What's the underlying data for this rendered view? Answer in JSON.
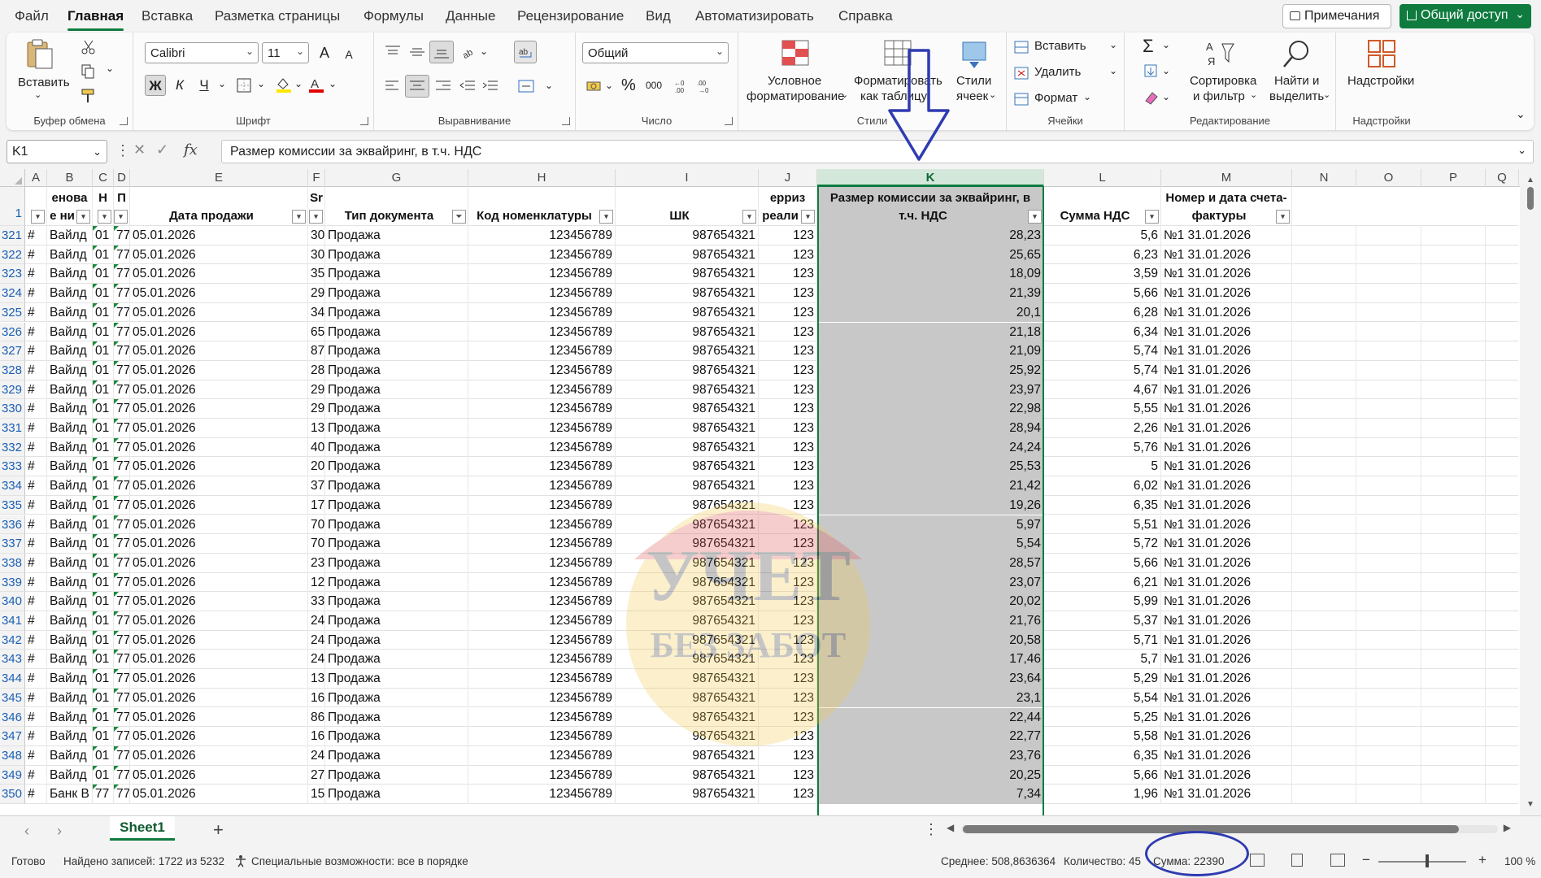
{
  "menu": {
    "items": [
      "Файл",
      "Главная",
      "Вставка",
      "Разметка страницы",
      "Формулы",
      "Данные",
      "Рецензирование",
      "Вид",
      "Автоматизировать",
      "Справка"
    ],
    "notes_label": "Примечания",
    "share_label": "Общий доступ"
  },
  "ribbon": {
    "clipboard": {
      "paste_label": "Вставить",
      "group_label": "Буфер обмена"
    },
    "font": {
      "name": "Calibri",
      "size": "11",
      "bold": "Ж",
      "italic": "К",
      "underline": "Ч",
      "group_label": "Шрифт",
      "grow": "A",
      "shrink": "A"
    },
    "alignment": {
      "group_label": "Выравнивание"
    },
    "number": {
      "format": "Общий",
      "percent": "%",
      "thousands": "000",
      "group_label": "Число"
    },
    "styles": {
      "cond_format_l1": "Условное",
      "cond_format_l2": "форматирование",
      "format_table_l1": "Форматировать",
      "format_table_l2": "как таблицу",
      "cell_styles_l1": "Стили",
      "cell_styles_l2": "ячеек",
      "group_label": "Стили"
    },
    "cells": {
      "insert": "Вставить",
      "delete": "Удалить",
      "format": "Формат",
      "group_label": "Ячейки"
    },
    "editing": {
      "sort_l1": "Сортировка",
      "sort_l2": "и фильтр",
      "find_l1": "Найти и",
      "find_l2": "выделить",
      "group_label": "Редактирование"
    },
    "addins": {
      "label": "Надстройки",
      "group_label": "Надстройки"
    }
  },
  "formula_bar": {
    "name_box": "K1",
    "fx": "fx",
    "content": "Размер комиссии за эквайринг, в т.ч. НДС"
  },
  "columns": [
    "A",
    "B",
    "C",
    "D",
    "E",
    "F",
    "G",
    "H",
    "I",
    "J",
    "K",
    "L",
    "M",
    "N",
    "O",
    "P",
    "Q"
  ],
  "header_row": {
    "number": "1",
    "B_l1": "енова",
    "B_l2": "е ни",
    "C_l1": "Н",
    "D_l1": "П",
    "E": "Дата продажи",
    "F_l1": "Sr",
    "G": "Тип документа",
    "H": "Код номенклатуры",
    "I": "ШК",
    "J_l1": "ерриз",
    "J_l2": "реали",
    "K_l1": "Размер комиссии за эквайринг, в",
    "K_l2": "т.ч. НДС",
    "L": "Сумма НДС",
    "M_l1": "Номер и дата счета-",
    "M_l2": "фактуры"
  },
  "rows": [
    {
      "n": "321",
      "a": "#",
      "b": "Вайлд",
      "c": "01",
      "d": "77",
      "e": "05.01.2026",
      "f": "30",
      "g": "Продажа",
      "h": "123456789",
      "i": "987654321",
      "j": "123",
      "k": "28,23",
      "l": "5,6",
      "m": "№1 31.01.2026"
    },
    {
      "n": "322",
      "a": "#",
      "b": "Вайлд",
      "c": "01",
      "d": "77",
      "e": "05.01.2026",
      "f": "30",
      "g": "Продажа",
      "h": "123456789",
      "i": "987654321",
      "j": "123",
      "k": "25,65",
      "l": "6,23",
      "m": "№1 31.01.2026"
    },
    {
      "n": "323",
      "a": "#",
      "b": "Вайлд",
      "c": "01",
      "d": "77",
      "e": "05.01.2026",
      "f": "35",
      "g": "Продажа",
      "h": "123456789",
      "i": "987654321",
      "j": "123",
      "k": "18,09",
      "l": "3,59",
      "m": "№1 31.01.2026"
    },
    {
      "n": "324",
      "a": "#",
      "b": "Вайлд",
      "c": "01",
      "d": "77",
      "e": "05.01.2026",
      "f": "29",
      "g": "Продажа",
      "h": "123456789",
      "i": "987654321",
      "j": "123",
      "k": "21,39",
      "l": "5,66",
      "m": "№1 31.01.2026"
    },
    {
      "n": "325",
      "a": "#",
      "b": "Вайлд",
      "c": "01",
      "d": "77",
      "e": "05.01.2026",
      "f": "34",
      "g": "Продажа",
      "h": "123456789",
      "i": "987654321",
      "j": "123",
      "k": "20,1",
      "l": "6,28",
      "m": "№1 31.01.2026"
    },
    {
      "n": "326",
      "a": "#",
      "b": "Вайлд",
      "c": "01",
      "d": "77",
      "e": "05.01.2026",
      "f": "65",
      "g": "Продажа",
      "h": "123456789",
      "i": "987654321",
      "j": "123",
      "k": "21,18",
      "l": "6,34",
      "m": "№1 31.01.2026"
    },
    {
      "n": "327",
      "a": "#",
      "b": "Вайлд",
      "c": "01",
      "d": "77",
      "e": "05.01.2026",
      "f": "87",
      "g": "Продажа",
      "h": "123456789",
      "i": "987654321",
      "j": "123",
      "k": "21,09",
      "l": "5,74",
      "m": "№1 31.01.2026"
    },
    {
      "n": "328",
      "a": "#",
      "b": "Вайлд",
      "c": "01",
      "d": "77",
      "e": "05.01.2026",
      "f": "28",
      "g": "Продажа",
      "h": "123456789",
      "i": "987654321",
      "j": "123",
      "k": "25,92",
      "l": "5,74",
      "m": "№1 31.01.2026"
    },
    {
      "n": "329",
      "a": "#",
      "b": "Вайлд",
      "c": "01",
      "d": "77",
      "e": "05.01.2026",
      "f": "29",
      "g": "Продажа",
      "h": "123456789",
      "i": "987654321",
      "j": "123",
      "k": "23,97",
      "l": "4,67",
      "m": "№1 31.01.2026"
    },
    {
      "n": "330",
      "a": "#",
      "b": "Вайлд",
      "c": "01",
      "d": "77",
      "e": "05.01.2026",
      "f": "29",
      "g": "Продажа",
      "h": "123456789",
      "i": "987654321",
      "j": "123",
      "k": "22,98",
      "l": "5,55",
      "m": "№1 31.01.2026"
    },
    {
      "n": "331",
      "a": "#",
      "b": "Вайлд",
      "c": "01",
      "d": "77",
      "e": "05.01.2026",
      "f": "13",
      "g": "Продажа",
      "h": "123456789",
      "i": "987654321",
      "j": "123",
      "k": "28,94",
      "l": "2,26",
      "m": "№1 31.01.2026"
    },
    {
      "n": "332",
      "a": "#",
      "b": "Вайлд",
      "c": "01",
      "d": "77",
      "e": "05.01.2026",
      "f": "40",
      "g": "Продажа",
      "h": "123456789",
      "i": "987654321",
      "j": "123",
      "k": "24,24",
      "l": "5,76",
      "m": "№1 31.01.2026"
    },
    {
      "n": "333",
      "a": "#",
      "b": "Вайлд",
      "c": "01",
      "d": "77",
      "e": "05.01.2026",
      "f": "20",
      "g": "Продажа",
      "h": "123456789",
      "i": "987654321",
      "j": "123",
      "k": "25,53",
      "l": "5",
      "m": "№1 31.01.2026"
    },
    {
      "n": "334",
      "a": "#",
      "b": "Вайлд",
      "c": "01",
      "d": "77",
      "e": "05.01.2026",
      "f": "37",
      "g": "Продажа",
      "h": "123456789",
      "i": "987654321",
      "j": "123",
      "k": "21,42",
      "l": "6,02",
      "m": "№1 31.01.2026"
    },
    {
      "n": "335",
      "a": "#",
      "b": "Вайлд",
      "c": "01",
      "d": "77",
      "e": "05.01.2026",
      "f": "17",
      "g": "Продажа",
      "h": "123456789",
      "i": "987654321",
      "j": "123",
      "k": "19,26",
      "l": "6,35",
      "m": "№1 31.01.2026"
    },
    {
      "n": "336",
      "a": "#",
      "b": "Вайлд",
      "c": "01",
      "d": "77",
      "e": "05.01.2026",
      "f": "70",
      "g": "Продажа",
      "h": "123456789",
      "i": "987654321",
      "j": "123",
      "k": "5,97",
      "l": "5,51",
      "m": "№1 31.01.2026"
    },
    {
      "n": "337",
      "a": "#",
      "b": "Вайлд",
      "c": "01",
      "d": "77",
      "e": "05.01.2026",
      "f": "70",
      "g": "Продажа",
      "h": "123456789",
      "i": "987654321",
      "j": "123",
      "k": "5,54",
      "l": "5,72",
      "m": "№1 31.01.2026"
    },
    {
      "n": "338",
      "a": "#",
      "b": "Вайлд",
      "c": "01",
      "d": "77",
      "e": "05.01.2026",
      "f": "23",
      "g": "Продажа",
      "h": "123456789",
      "i": "987654321",
      "j": "123",
      "k": "28,57",
      "l": "5,66",
      "m": "№1 31.01.2026"
    },
    {
      "n": "339",
      "a": "#",
      "b": "Вайлд",
      "c": "01",
      "d": "77",
      "e": "05.01.2026",
      "f": "12",
      "g": "Продажа",
      "h": "123456789",
      "i": "987654321",
      "j": "123",
      "k": "23,07",
      "l": "6,21",
      "m": "№1 31.01.2026"
    },
    {
      "n": "340",
      "a": "#",
      "b": "Вайлд",
      "c": "01",
      "d": "77",
      "e": "05.01.2026",
      "f": "33",
      "g": "Продажа",
      "h": "123456789",
      "i": "987654321",
      "j": "123",
      "k": "20,02",
      "l": "5,99",
      "m": "№1 31.01.2026"
    },
    {
      "n": "341",
      "a": "#",
      "b": "Вайлд",
      "c": "01",
      "d": "77",
      "e": "05.01.2026",
      "f": "24",
      "g": "Продажа",
      "h": "123456789",
      "i": "987654321",
      "j": "123",
      "k": "21,76",
      "l": "5,37",
      "m": "№1 31.01.2026"
    },
    {
      "n": "342",
      "a": "#",
      "b": "Вайлд",
      "c": "01",
      "d": "77",
      "e": "05.01.2026",
      "f": "24",
      "g": "Продажа",
      "h": "123456789",
      "i": "987654321",
      "j": "123",
      "k": "20,58",
      "l": "5,71",
      "m": "№1 31.01.2026"
    },
    {
      "n": "343",
      "a": "#",
      "b": "Вайлд",
      "c": "01",
      "d": "77",
      "e": "05.01.2026",
      "f": "24",
      "g": "Продажа",
      "h": "123456789",
      "i": "987654321",
      "j": "123",
      "k": "17,46",
      "l": "5,7",
      "m": "№1 31.01.2026"
    },
    {
      "n": "344",
      "a": "#",
      "b": "Вайлд",
      "c": "01",
      "d": "77",
      "e": "05.01.2026",
      "f": "13",
      "g": "Продажа",
      "h": "123456789",
      "i": "987654321",
      "j": "123",
      "k": "23,64",
      "l": "5,29",
      "m": "№1 31.01.2026"
    },
    {
      "n": "345",
      "a": "#",
      "b": "Вайлд",
      "c": "01",
      "d": "77",
      "e": "05.01.2026",
      "f": "16",
      "g": "Продажа",
      "h": "123456789",
      "i": "987654321",
      "j": "123",
      "k": "23,1",
      "l": "5,54",
      "m": "№1 31.01.2026"
    },
    {
      "n": "346",
      "a": "#",
      "b": "Вайлд",
      "c": "01",
      "d": "77",
      "e": "05.01.2026",
      "f": "86",
      "g": "Продажа",
      "h": "123456789",
      "i": "987654321",
      "j": "123",
      "k": "22,44",
      "l": "5,25",
      "m": "№1 31.01.2026"
    },
    {
      "n": "347",
      "a": "#",
      "b": "Вайлд",
      "c": "01",
      "d": "77",
      "e": "05.01.2026",
      "f": "16",
      "g": "Продажа",
      "h": "123456789",
      "i": "987654321",
      "j": "123",
      "k": "22,77",
      "l": "5,58",
      "m": "№1 31.01.2026"
    },
    {
      "n": "348",
      "a": "#",
      "b": "Вайлд",
      "c": "01",
      "d": "77",
      "e": "05.01.2026",
      "f": "24",
      "g": "Продажа",
      "h": "123456789",
      "i": "987654321",
      "j": "123",
      "k": "23,76",
      "l": "6,35",
      "m": "№1 31.01.2026"
    },
    {
      "n": "349",
      "a": "#",
      "b": "Вайлд",
      "c": "01",
      "d": "77",
      "e": "05.01.2026",
      "f": "27",
      "g": "Продажа",
      "h": "123456789",
      "i": "987654321",
      "j": "123",
      "k": "20,25",
      "l": "5,66",
      "m": "№1 31.01.2026"
    },
    {
      "n": "350",
      "a": "#",
      "b": "Банк В",
      "c": "77",
      "d": "77",
      "e": "05.01.2026",
      "f": "15",
      "g": "Продажа",
      "h": "123456789",
      "i": "987654321",
      "j": "123",
      "k": "7,34",
      "l": "1,96",
      "m": "№1 31.01.2026"
    }
  ],
  "sheet": {
    "tab_name": "Sheet1",
    "add": "+"
  },
  "status": {
    "ready": "Готово",
    "records": "Найдено записей: 1722 из 5232",
    "accessibility": "Специальные возможности: все в порядке",
    "average": "Среднее: 508,8636364",
    "count": "Количество: 45",
    "sum": "Сумма: 22390",
    "zoom": "100 %"
  },
  "watermark": {
    "line1": "УЧЕТ",
    "line2": "БЕЗ ЗАБОТ"
  },
  "colors": {
    "accent": "#0f7b3f",
    "annotation": "#2f3bb0",
    "selection": "#c8c8c8"
  }
}
